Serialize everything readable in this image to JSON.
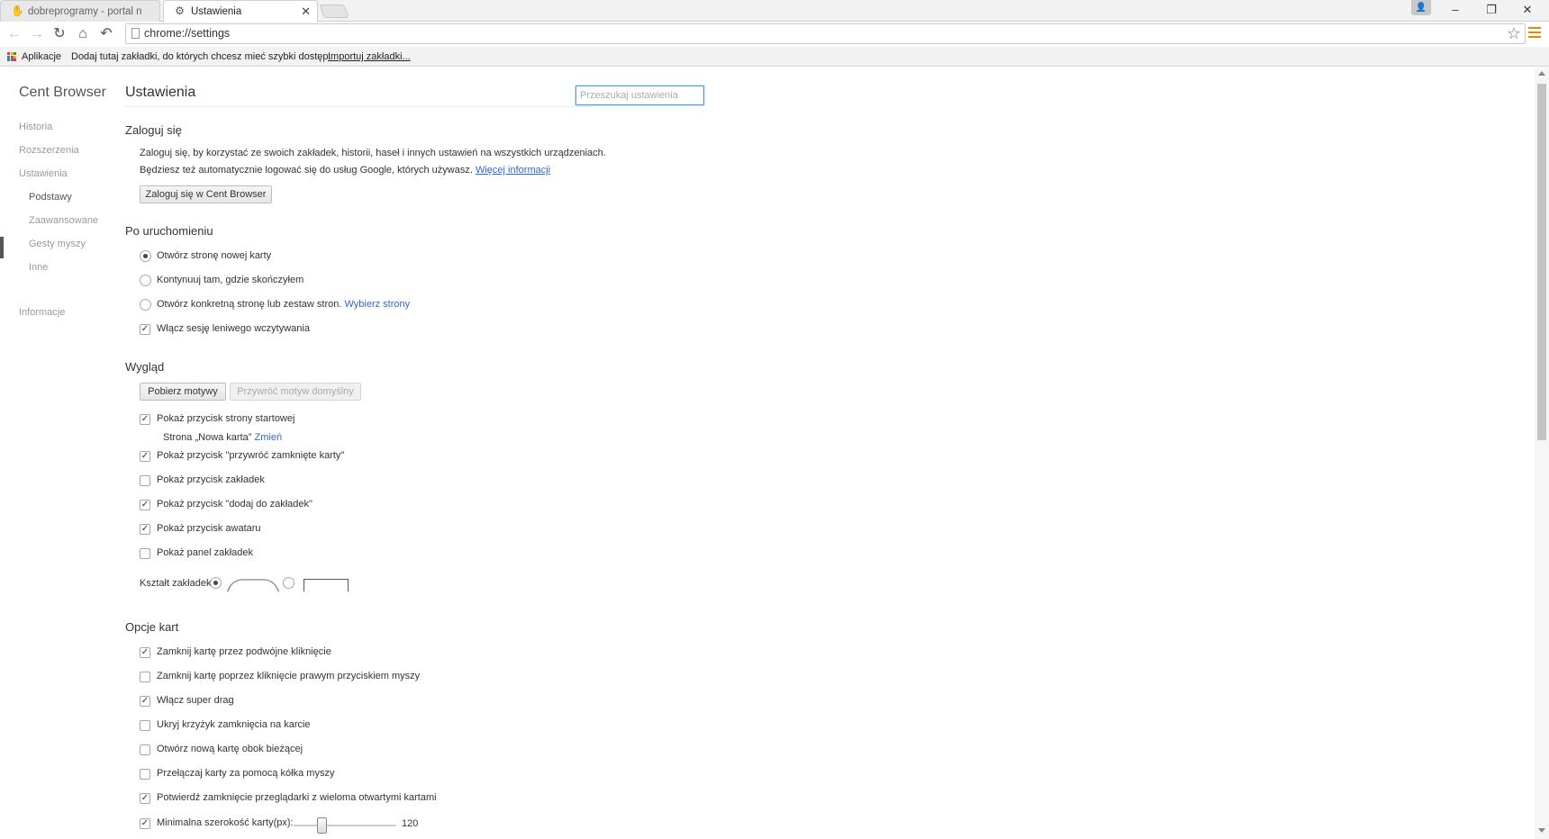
{
  "tabs": [
    {
      "title": "dobreprogramy - portal n",
      "icon": "dobreprogramy-icon"
    },
    {
      "title": "Ustawienia",
      "icon": "gear-icon"
    }
  ],
  "window_controls": {
    "minimize": "–",
    "restore": "❐",
    "close": "✕"
  },
  "toolbar": {
    "url": "chrome://settings"
  },
  "bookmarks_bar": {
    "apps_label": "Aplikacje",
    "hint": "Dodaj tutaj zakładki, do których chcesz mieć szybki dostęp.",
    "import_link": "Importuj zakładki..."
  },
  "sidebar": {
    "brand": "Cent Browser",
    "items": [
      "Historia",
      "Rozszerzenia",
      "Ustawienia"
    ],
    "subitems": [
      "Podstawy",
      "Zaawansowane",
      "Gesty myszy",
      "Inne"
    ],
    "info": "Informacje"
  },
  "page": {
    "title": "Ustawienia",
    "search_placeholder": "Przeszukaj ustawienia"
  },
  "signin": {
    "title": "Zaloguj się",
    "text1": "Zaloguj się, by korzystać ze swoich zakładek, historii, haseł i innych ustawień na wszystkich urządzeniach.",
    "text2": "Będziesz też automatycznie logować się do usług Google, których używasz.",
    "more_link": "Więcej informacji",
    "button": "Zaloguj się w Cent Browser"
  },
  "startup": {
    "title": "Po uruchomieniu",
    "options": [
      "Otwórz stronę nowej karty",
      "Kontynuuj tam, gdzie skończyłem",
      "Otwórz konkretną stronę lub zestaw stron."
    ],
    "pages_link": "Wybierz strony",
    "lazy_label": "Włącz sesję leniwego wczytywania"
  },
  "appearance": {
    "title": "Wygląd",
    "get_themes": "Pobierz motywy",
    "reset_theme": "Przywróć motyw domyślny",
    "home_button": "Pokaż przycisk strony startowej",
    "home_page_text": "Strona „Nowa karta”",
    "change_link": "Zmień",
    "restore_tabs_button": "Pokaż przycisk \"przywróć zamknięte karty\"",
    "bookmarks_button": "Pokaż przycisk zakładek",
    "add_bookmark_button": "Pokaż przycisk \"dodaj do zakładek\"",
    "avatar_button": "Pokaż przycisk awataru",
    "bookmarks_panel": "Pokaż panel zakładek",
    "tab_shape_label": "Kształt zakładek:"
  },
  "tab_options": {
    "title": "Opcje kart",
    "items": [
      "Zamknij kartę przez podwójne kliknięcie",
      "Zamknij kartę poprzez kliknięcie prawym przyciskiem myszy",
      "Włącz super drag",
      "Ukryj krzyżyk zamknięcia na karcie",
      "Otwórz nową kartę obok bieżącej",
      "Przełączaj karty za pomocą kółka myszy",
      "Potwierdź zamknięcie przeglądarki z wieloma otwartymi kartami"
    ],
    "min_width_label": "Minimalna szerokość karty(px):",
    "min_width_value": "120",
    "min_width_fraction": 0.25
  },
  "colors": {
    "accent": "#3366cc",
    "search_focus": "#4d90fe",
    "menu": "#e58a00"
  }
}
